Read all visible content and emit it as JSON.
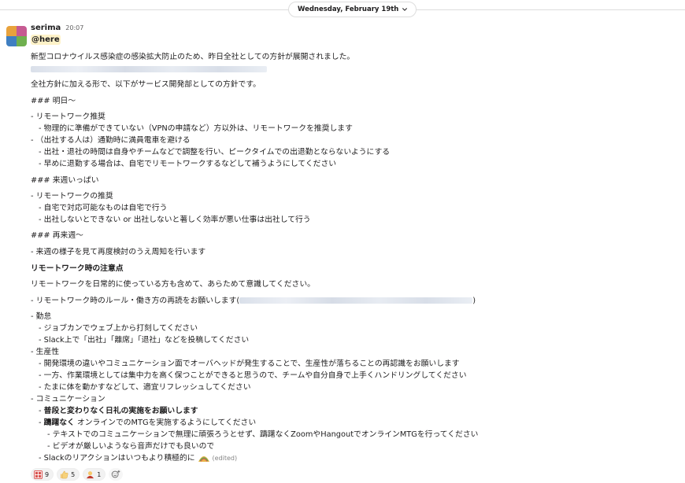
{
  "date_divider": {
    "label": "Wednesday, February 19th"
  },
  "message": {
    "username": "serima",
    "time": "20:07",
    "mention": "@here",
    "lines": {
      "l1": "新型コロナウイルス感染症の感染拡大防止のため、昨日全社としての方針が展開されました。",
      "l3": "全社方針に加える形で、以下がサービス開発部としての方針です。",
      "l4": "### 明日〜",
      "l5": "- リモートワーク推奨",
      "l6": "- 物理的に準備ができていない（VPNの申請など）方以外は、リモートワークを推奨します",
      "l7": "- （出社する人は）通勤時に満員電車を避ける",
      "l8": "- 出社・退社の時間は自身やチームなどで調整を行い、ピークタイムでの出退勤とならないようにする",
      "l9": "- 早めに退勤する場合は、自宅でリモートワークするなどして補うようにしてください",
      "l10": "### 来週いっぱい",
      "l11": "- リモートワークの推奨",
      "l12": "- 自宅で対応可能なものは自宅で行う",
      "l13": "- 出社しないとできない or 出社しないと著しく効率が悪い仕事は出社して行う",
      "l14": "### 再来週〜",
      "l15": "- 来週の様子を見て再度検討のうえ周知を行います",
      "l16": "リモートワーク時の注意点",
      "l17": "リモートワークを日常的に使っている方も含めて、あらためて意識してください。",
      "l18a": "- リモートワーク時のルール・働き方の再読をお願いします(",
      "l18b": ")",
      "l19": "- 勤怠",
      "l20": "- ジョブカンでウェブ上から打刻してください",
      "l21": "- Slack上で「出社」「離席」「退社」などを投稿してください",
      "l22": "- 生産性",
      "l23": "- 開発環境の違いやコミュニケーション面でオーバヘッドが発生することで、生産性が落ちることの再認識をお願いします",
      "l24": "- 一方、作業環境としては集中力を高く保つことができると思うので、チームや自分自身で上手くハンドリングしてください",
      "l25": "- たまに体を動かすなどして、適宜リフレッシュしてください",
      "l26": "- コミュニケーション",
      "l27": "普段と変わりなく日礼の実施をお願いします",
      "l28a": "躊躇なく",
      "l28b": " オンラインでのMTGを実施するようにしてください",
      "l29": "- テキストでのコミュニケーションで無理に頑張ろうとせず、躊躇なくZoomやHangoutでオンラインMTGを行ってください",
      "l30": "- ビデオが厳しいようなら音声だけでも良いので",
      "l31": "- Slackのリアクションはいつもより積極的に",
      "dash": "- ",
      "edited": "(edited)"
    }
  },
  "reactions": [
    {
      "icon": "naruhodo-icon",
      "count": "9"
    },
    {
      "icon": "thumbs-up-icon",
      "count": "5"
    },
    {
      "icon": "bow-icon",
      "count": "1"
    }
  ],
  "colors": {
    "mention_bg": "#fef2c8",
    "reaction_bg": "#f2f2f2",
    "text": "#1d1c1d",
    "muted": "#616061"
  }
}
